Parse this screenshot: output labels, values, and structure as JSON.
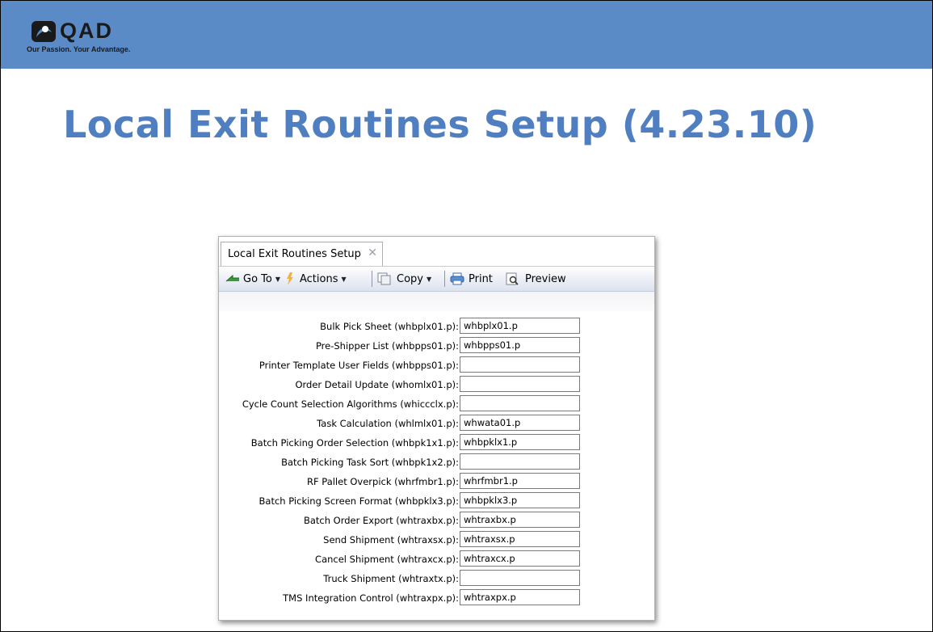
{
  "logo": {
    "text": "QAD",
    "tagline": "Our Passion. Your Advantage."
  },
  "slide": {
    "title": "Local Exit Routines Setup (4.23.10)"
  },
  "colors": {
    "header_band": "#5b8bc7",
    "title": "#4f7fc0"
  },
  "app": {
    "tab_label": "Local Exit Routines Setup",
    "toolbar": {
      "goto_label": "Go To",
      "actions_label": "Actions",
      "copy_label": "Copy",
      "print_label": "Print",
      "preview_label": "Preview"
    },
    "fields": [
      {
        "label": "Bulk Pick Sheet (whbplx01.p):",
        "value": "whbplx01.p"
      },
      {
        "label": "Pre-Shipper List (whbpps01.p):",
        "value": "whbpps01.p"
      },
      {
        "label": "Printer Template User Fields (whbpps01.p):",
        "value": ""
      },
      {
        "label": "Order Detail Update (whomlx01.p):",
        "value": ""
      },
      {
        "label": "Cycle Count Selection Algorithms (whiccclx.p):",
        "value": ""
      },
      {
        "label": "Task Calculation (whlmlx01.p):",
        "value": "whwata01.p"
      },
      {
        "label": "Batch Picking Order Selection (whbpk1x1.p):",
        "value": "whbpklx1.p"
      },
      {
        "label": "Batch Picking Task Sort (whbpk1x2.p):",
        "value": ""
      },
      {
        "label": "RF Pallet Overpick (whrfmbr1.p):",
        "value": "whrfmbr1.p"
      },
      {
        "label": "Batch Picking Screen Format (whbpklx3.p):",
        "value": "whbpklx3.p"
      },
      {
        "label": "Batch Order Export (whtraxbx.p):",
        "value": "whtraxbx.p"
      },
      {
        "label": "Send Shipment (whtraxsx.p):",
        "value": "whtraxsx.p"
      },
      {
        "label": "Cancel Shipment (whtraxcx.p):",
        "value": "whtraxcx.p"
      },
      {
        "label": "Truck Shipment (whtraxtx.p):",
        "value": ""
      },
      {
        "label": "TMS Integration Control (whtraxpx.p):",
        "value": "whtraxpx.p"
      }
    ]
  }
}
